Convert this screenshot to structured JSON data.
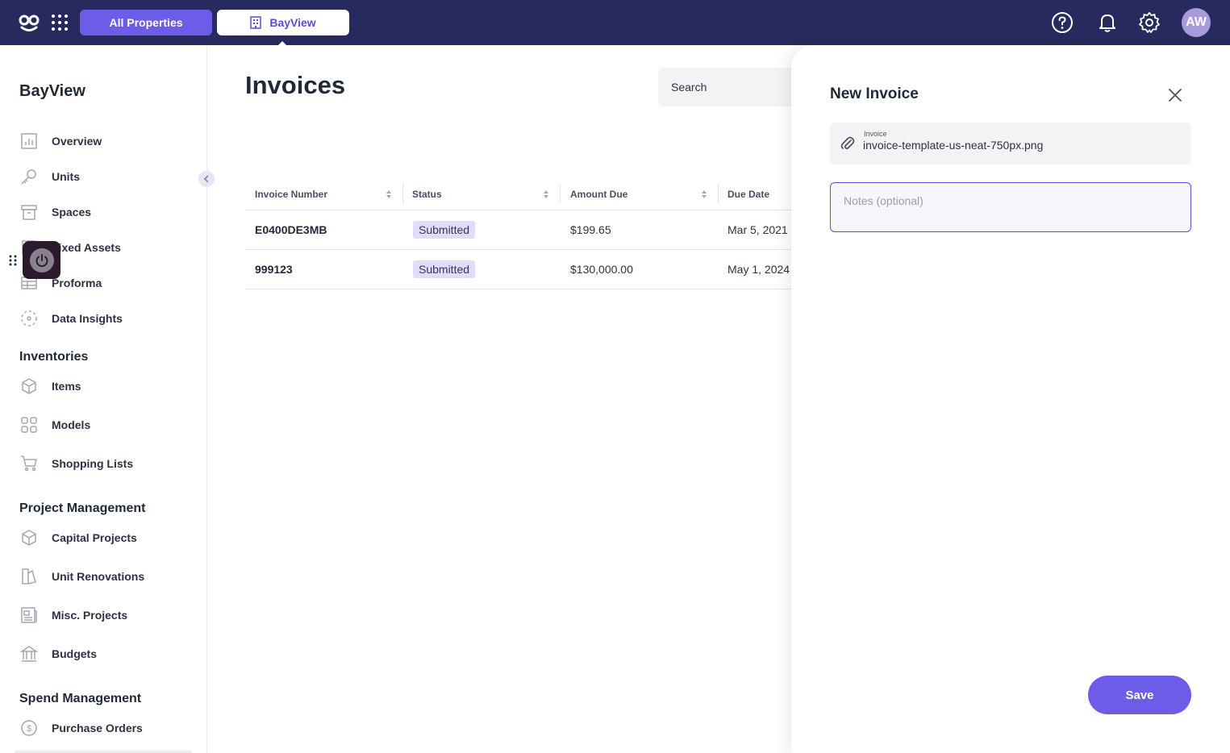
{
  "topbar": {
    "all_properties_label": "All Properties",
    "property_label": "BayView",
    "avatar_initials": "AW"
  },
  "sidebar": {
    "title": "BayView",
    "items": [
      {
        "label": "Overview",
        "icon": "bar-chart-icon"
      },
      {
        "label": "Units",
        "icon": "key-icon"
      },
      {
        "label": "Spaces",
        "icon": "box-icon"
      },
      {
        "label": "Fixed Assets",
        "icon": "asset-icon"
      },
      {
        "label": "Proforma",
        "icon": "table-icon"
      },
      {
        "label": "Data Insights",
        "icon": "insights-icon"
      }
    ],
    "sections": [
      {
        "title": "Inventories",
        "items": [
          {
            "label": "Items",
            "icon": "cube-icon"
          },
          {
            "label": "Models",
            "icon": "grid-icon"
          },
          {
            "label": "Shopping Lists",
            "icon": "cart-icon"
          }
        ]
      },
      {
        "title": "Project Management",
        "items": [
          {
            "label": "Capital Projects",
            "icon": "cube-icon"
          },
          {
            "label": "Unit Renovations",
            "icon": "paint-icon"
          },
          {
            "label": "Misc. Projects",
            "icon": "document-icon"
          },
          {
            "label": "Budgets",
            "icon": "bank-icon"
          }
        ]
      },
      {
        "title": "Spend Management",
        "items": [
          {
            "label": "Purchase Orders",
            "icon": "dollar-icon"
          }
        ]
      }
    ]
  },
  "main": {
    "title": "Invoices",
    "search_placeholder": "Search",
    "columns": [
      "Invoice Number",
      "Status",
      "Amount Due",
      "Due Date"
    ],
    "rows": [
      {
        "number": "E0400DE3MB",
        "status": "Submitted",
        "amount": "$199.65",
        "due": "Mar 5, 2021"
      },
      {
        "number": "999123",
        "status": "Submitted",
        "amount": "$130,000.00",
        "due": "May 1, 2024"
      }
    ]
  },
  "drawer": {
    "title": "New Invoice",
    "file_label": "Invoice",
    "file_value": "invoice-template-us-neat-750px.png",
    "notes_placeholder": "Notes (optional)",
    "save_label": "Save"
  },
  "colors": {
    "topbar": "#262a5e",
    "accent": "#6c5ce7",
    "badge_bg": "#e1dcfb"
  }
}
